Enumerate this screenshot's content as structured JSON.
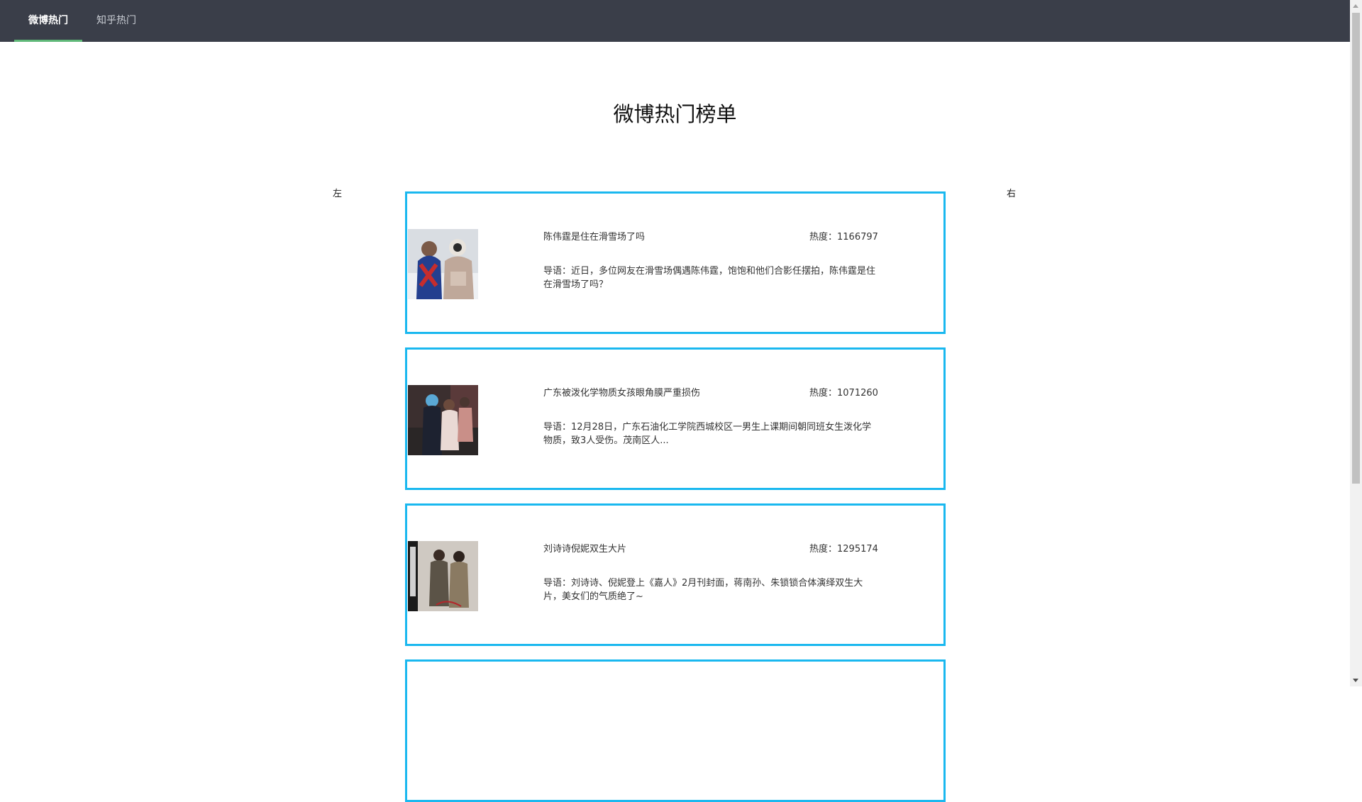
{
  "tabs": [
    {
      "label": "微博热门",
      "active": true
    },
    {
      "label": "知乎热门",
      "active": false
    }
  ],
  "page_title": "微博热门榜单",
  "nav": {
    "left": "左",
    "right": "右"
  },
  "items": [
    {
      "title": "陈伟霆是住在滑雪场了吗",
      "heat": "热度：1166797",
      "summary": "导语：近日，多位网友在滑雪场偶遇陈伟霆，饱饱和他们合影任摆拍，陈伟霆是住在滑雪场了吗？",
      "image": "ski-photo"
    },
    {
      "title": "广东被泼化学物质女孩眼角膜严重损伤",
      "heat": "热度：1071260",
      "summary": "导语：12月28日，广东石油化工学院西城校区一男生上课期间朝同班女生泼化学物质，致3人受伤。茂南区人...",
      "image": "news-photo"
    },
    {
      "title": "刘诗诗倪妮双生大片",
      "heat": "热度：1295174",
      "summary": "导语：刘诗诗、倪妮登上《嘉人》2月刊封面，蒋南孙、朱锁锁合体演绎双生大片，美女们的气质绝了~",
      "image": "magazine-cover"
    }
  ],
  "colors": {
    "topbar": "#3a3e49",
    "active_tab_indicator": "#5fb878",
    "card_border": "#1ab8ef"
  }
}
